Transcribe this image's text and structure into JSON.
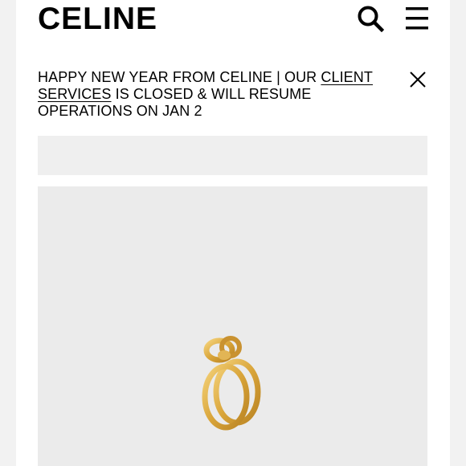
{
  "brand": {
    "logo": "CELINE"
  },
  "header": {
    "icons": [
      "search-icon",
      "menu-icon"
    ]
  },
  "banner": {
    "text_before": "HAPPY NEW YEAR FROM CELINE | OUR ",
    "link": "CLIENT SERVICES",
    "text_after": " IS CLOSED & WILL RESUME OPERATIONS ON JAN 2",
    "close_icon": "close-icon"
  },
  "product": {
    "image": "gold-knot-ring",
    "accent": "#d9a53a"
  },
  "colors": {
    "background": "#ffffff",
    "panel": "#ebebeb",
    "text": "#000000"
  }
}
